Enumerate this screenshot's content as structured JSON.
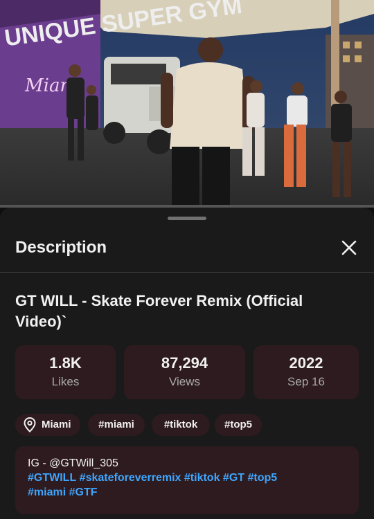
{
  "video": {
    "wall_text": "UNIQUE SUPER GYM",
    "wall_script": "Miami"
  },
  "sheet": {
    "title": "Description",
    "close_icon": "close-icon"
  },
  "video_info": {
    "title": "GT WILL - Skate Forever Remix (Official Video)`"
  },
  "stats": [
    {
      "value": "1.8K",
      "label": "Likes"
    },
    {
      "value": "87,294",
      "label": "Views"
    },
    {
      "value": "2022",
      "label": "Sep 16"
    }
  ],
  "chips": {
    "location": {
      "icon": "location-pin-icon",
      "label": "Miami"
    },
    "tags": [
      "#miami",
      "#tiktok",
      "#top5"
    ]
  },
  "description": {
    "line1": "IG - @GTWill_305",
    "hashtags_line2": [
      "#GTWILL",
      "#skateforeverremix",
      "#tiktok",
      "#GT",
      "#top5"
    ],
    "hashtags_line3": [
      "#miami",
      "#GTF"
    ]
  },
  "colors": {
    "background": "#1a1a1a",
    "card": "#2e1b1f",
    "link": "#3ea6ff",
    "secondary_text": "#aaaaaa"
  }
}
